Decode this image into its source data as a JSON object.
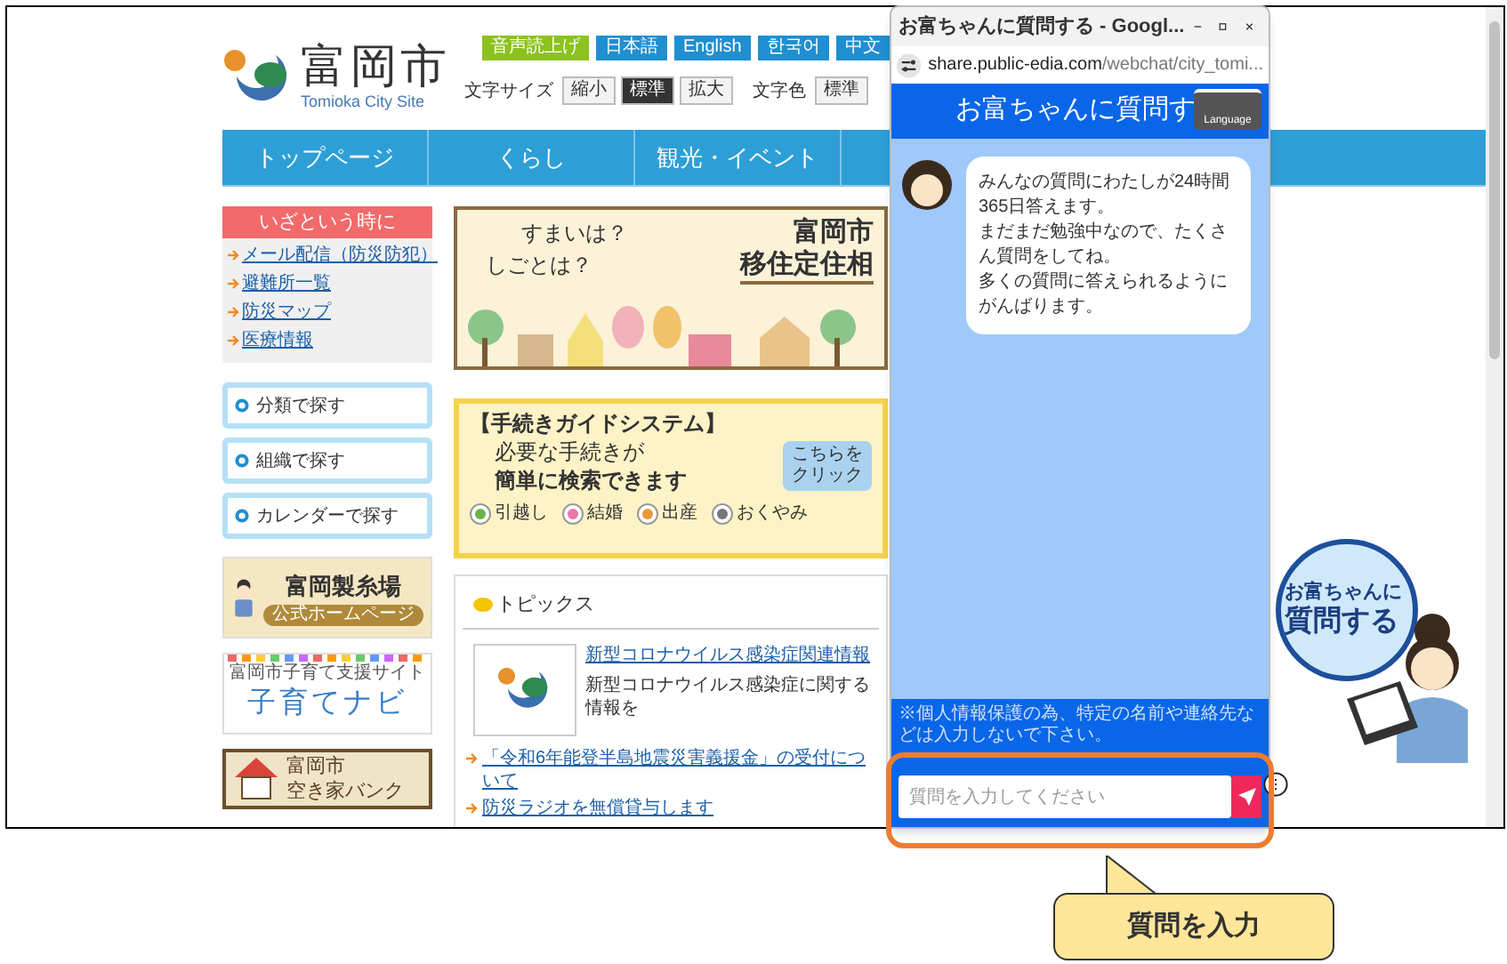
{
  "site": {
    "logo": {
      "name": "富岡市",
      "subtitle": "Tomioka City Site"
    },
    "top_buttons": [
      {
        "label": "音声読上げ",
        "kind": "voice"
      },
      {
        "label": "日本語",
        "kind": "language"
      },
      {
        "label": "English",
        "kind": "language"
      },
      {
        "label": "한국어",
        "kind": "language"
      },
      {
        "label": "中文",
        "kind": "language"
      }
    ],
    "text_size": {
      "label": "文字サイズ",
      "options": [
        {
          "label": "縮小",
          "selected": false
        },
        {
          "label": "標準",
          "selected": true
        },
        {
          "label": "拡大",
          "selected": false
        }
      ]
    },
    "text_color": {
      "label": "文字色",
      "options": [
        {
          "label": "標準",
          "selected": false
        }
      ]
    },
    "nav": [
      "トップページ",
      "くらし",
      "観光・イベント"
    ],
    "emergency": {
      "title": "いざという時に",
      "links": [
        "メール配信（防災防犯）",
        "避難所一覧",
        "防災マップ",
        "医療情報"
      ]
    },
    "search_buttons": [
      "分類で探す",
      "組織で探す",
      "カレンダーで探す"
    ],
    "side_banners": [
      {
        "kind": "silk_mill",
        "title": "富岡製糸場",
        "subtitle": "公式ホームページ"
      },
      {
        "kind": "parenting",
        "title": "富岡市子育て支援サイト",
        "subtitle": "子育てナビ"
      },
      {
        "kind": "vacant_house",
        "title": "富岡市",
        "subtitle": "空き家バンク"
      }
    ],
    "relocation_banner": {
      "questions": [
        "すまいは？",
        "しごとは？"
      ],
      "title": [
        "富岡市",
        "移住定住相"
      ]
    },
    "guide_banner": {
      "title": "【手続きガイドシステム】",
      "lines": [
        "必要な手続きが",
        "簡単に検索できます"
      ],
      "button": [
        "こちらを",
        "クリック"
      ],
      "tags": [
        "引越し",
        "結婚",
        "出産",
        "おくやみ"
      ]
    },
    "topics": {
      "title": "トピックス",
      "feature": {
        "link": "新型コロナウイルス感染症関連情報",
        "text": "新型コロナウイルス感染症に関する情報を"
      },
      "links": [
        "「令和6年能登半島地震災害義援金」の受付について",
        "防災ラジオを無償貸与します"
      ]
    },
    "chat_promo": [
      "お富ちゃんに",
      "質問する"
    ]
  },
  "popup": {
    "title": "お富ちゃんに質問する - Googl...",
    "url_host": "share.public-edia.com",
    "url_path": "/webchat/city_tomi...",
    "header": "お富ちゃんに質問す",
    "language_button": "Language",
    "message": [
      "みんなの質問にわたしが24時間365日答えます。",
      "まだまだ勉強中なので、たくさん質問をしてね。",
      "多くの質問に答えられるようにがんばります。"
    ],
    "notice": "※個人情報保護の為、特定の名前や連絡先などは入力しないで下さい。",
    "input_placeholder": "質問を入力してください"
  },
  "callout": "質問を入力"
}
